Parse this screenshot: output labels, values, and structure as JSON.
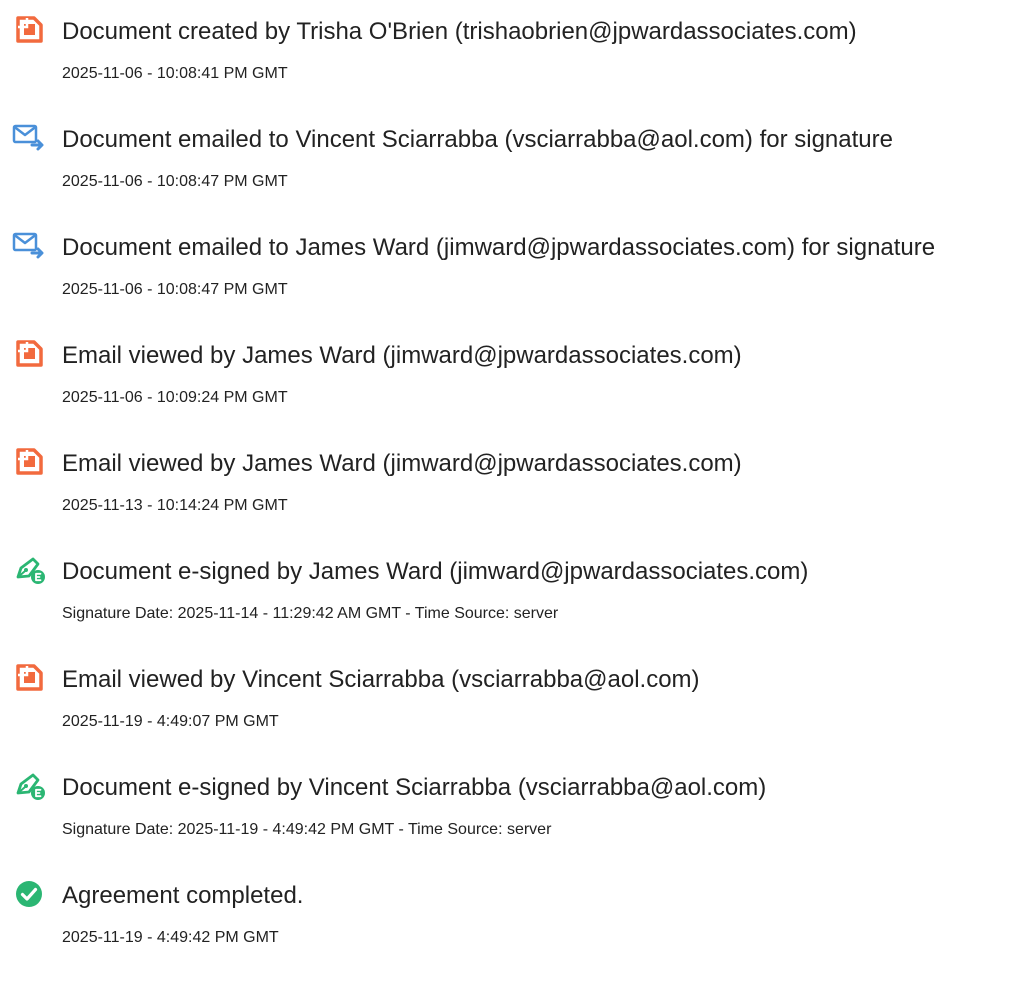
{
  "colors": {
    "document_icon": "#f26a3e",
    "email_icon": "#4a90d9",
    "signed_icon": "#2bb673",
    "completed_icon": "#2bb673",
    "text": "#222222"
  },
  "events": [
    {
      "icon": "document-icon",
      "title": "Document created by Trisha O'Brien (trishaobrien@jpwardassociates.com)",
      "detail": "2025-11-06 - 10:08:41 PM GMT"
    },
    {
      "icon": "email-sent-icon",
      "title": "Document emailed to Vincent Sciarrabba (vsciarrabba@aol.com) for signature",
      "detail": "2025-11-06 - 10:08:47 PM GMT"
    },
    {
      "icon": "email-sent-icon",
      "title": "Document emailed to James Ward (jimward@jpwardassociates.com) for signature",
      "detail": "2025-11-06 - 10:08:47 PM GMT"
    },
    {
      "icon": "document-icon",
      "title": "Email viewed by James Ward (jimward@jpwardassociates.com)",
      "detail": "2025-11-06 - 10:09:24 PM GMT"
    },
    {
      "icon": "document-icon",
      "title": "Email viewed by James Ward (jimward@jpwardassociates.com)",
      "detail": "2025-11-13 - 10:14:24 PM GMT"
    },
    {
      "icon": "esign-pen-icon",
      "title": "Document e-signed by James Ward (jimward@jpwardassociates.com)",
      "detail": "Signature Date: 2025-11-14 - 11:29:42 AM GMT - Time Source: server"
    },
    {
      "icon": "document-icon",
      "title": "Email viewed by Vincent Sciarrabba (vsciarrabba@aol.com)",
      "detail": "2025-11-19 - 4:49:07 PM GMT"
    },
    {
      "icon": "esign-pen-icon",
      "title": "Document e-signed by Vincent Sciarrabba (vsciarrabba@aol.com)",
      "detail": "Signature Date: 2025-11-19 - 4:49:42 PM GMT - Time Source: server"
    },
    {
      "icon": "checkmark-circle-icon",
      "title": "Agreement completed.",
      "detail": "2025-11-19 - 4:49:42 PM GMT"
    }
  ]
}
